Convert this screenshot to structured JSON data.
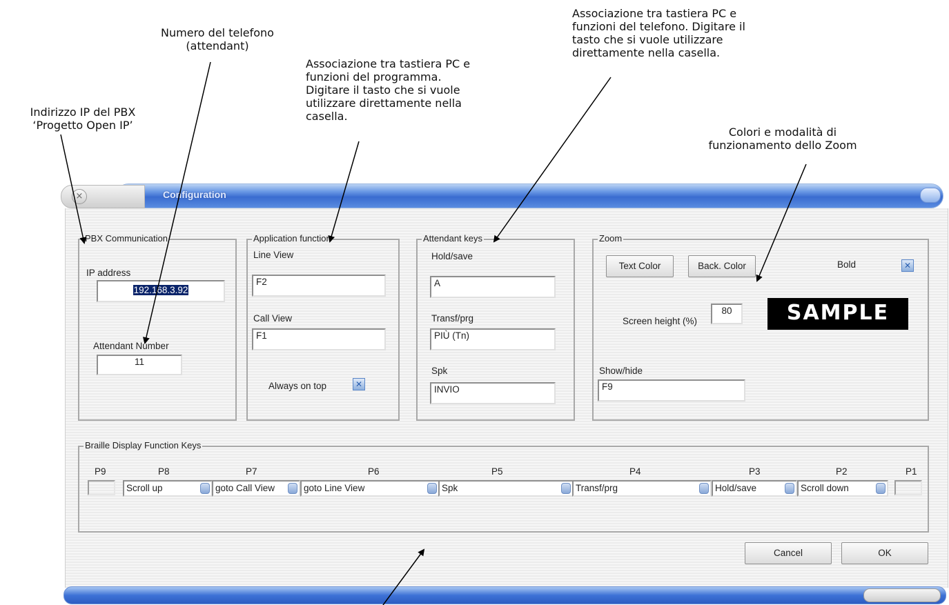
{
  "annotations": {
    "pbx_ip": "Indirizzo IP del PBX\n‘Progetto Open IP’",
    "phone_number": "Numero del telefono\n(attendant)",
    "app_keys": "Associazione tra tastiera PC e\nfunzioni del programma.\nDigitare il tasto che si vuole\nutilizzare direttamente nella\ncasella.",
    "phone_keys": "Associazione tra tastiera PC e\nfunzioni del telefono. Digitare il\ntasto che si vuole utilizzare\ndirettamente nella casella.",
    "zoom": "Colori e modalità di\nfunzionamento dello Zoom"
  },
  "window": {
    "title": "Configuration",
    "close_glyph": "×"
  },
  "pbx": {
    "legend": "PBX Communication",
    "ip_label": "IP address",
    "ip_value": "192.168.3.92",
    "attendant_label": "Attendant Number",
    "attendant_value": "11"
  },
  "app": {
    "legend": "Application function",
    "line_view_label": "Line View",
    "line_view_value": "F2",
    "call_view_label": "Call View",
    "call_view_value": "F1",
    "always_on_top_label": "Always on top",
    "always_on_top_checked": true
  },
  "attendant_keys": {
    "legend": "Attendant keys",
    "hold_label": "Hold/save",
    "hold_value": "A",
    "transf_label": "Transf/prg",
    "transf_value": "PIÙ (Tn)",
    "spk_label": "Spk",
    "spk_value": "INVIO"
  },
  "zoom": {
    "legend": "Zoom",
    "text_color_button": "Text Color",
    "back_color_button": "Back. Color",
    "bold_label": "Bold",
    "bold_checked": true,
    "screen_height_label": "Screen height (%)",
    "screen_height_value": "80",
    "sample_text": "SAMPLE",
    "sample_bg": "#000000",
    "sample_fg": "#ffffff",
    "show_hide_label": "Show/hide",
    "show_hide_value": "F9"
  },
  "braille": {
    "legend": "Braille Display Function Keys",
    "keys": [
      {
        "label": "P9",
        "value": ""
      },
      {
        "label": "P8",
        "value": "Scroll up"
      },
      {
        "label": "P7",
        "value": "goto Call View"
      },
      {
        "label": "P6",
        "value": "goto Line View"
      },
      {
        "label": "P5",
        "value": "Spk"
      },
      {
        "label": "P4",
        "value": "Transf/prg"
      },
      {
        "label": "P3",
        "value": "Hold/save"
      },
      {
        "label": "P2",
        "value": "Scroll down"
      },
      {
        "label": "P1",
        "value": ""
      }
    ]
  },
  "buttons": {
    "cancel": "Cancel",
    "ok": "OK"
  },
  "colors": {
    "titlebar_blue": "#3a6cd0",
    "checkbox_blue": "#5a86c8",
    "arrow": "#000000"
  }
}
